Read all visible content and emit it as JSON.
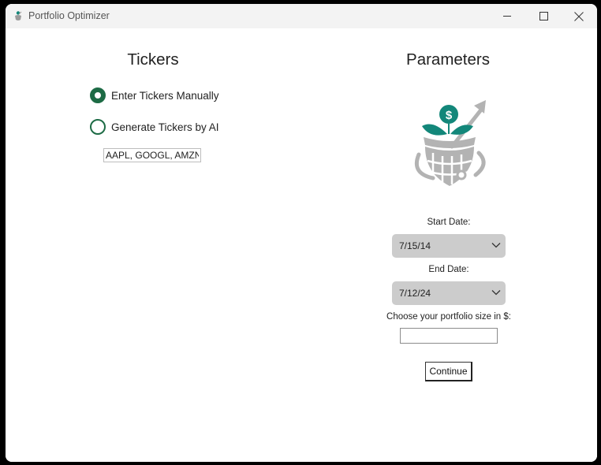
{
  "window": {
    "title": "Portfolio Optimizer"
  },
  "tickers": {
    "heading": "Tickers",
    "options": [
      {
        "label": "Enter Tickers Manually",
        "selected": true
      },
      {
        "label": "Generate Tickers by AI",
        "selected": false
      }
    ],
    "input_value": "AAPL, GOOGL, AMZN"
  },
  "parameters": {
    "heading": "Parameters",
    "start_label": "Start Date:",
    "start_value": "7/15/14",
    "end_label": "End Date:",
    "end_value": "7/12/24",
    "size_label": "Choose your portfolio size in $:",
    "size_value": "",
    "continue_label": "Continue"
  },
  "icons": {
    "app": "portfolio-app-icon",
    "logo": "portfolio-growth-logo",
    "minimize": "minimize-icon",
    "maximize": "maximize-icon",
    "close": "close-icon",
    "dropdown": "chevron-down-icon"
  },
  "colors": {
    "accent": "#1d6b45",
    "logo_teal": "#13877a",
    "logo_gray": "#b3b3b3",
    "select_bg": "#cccccc",
    "titlebar_bg": "#f3f3f3"
  }
}
